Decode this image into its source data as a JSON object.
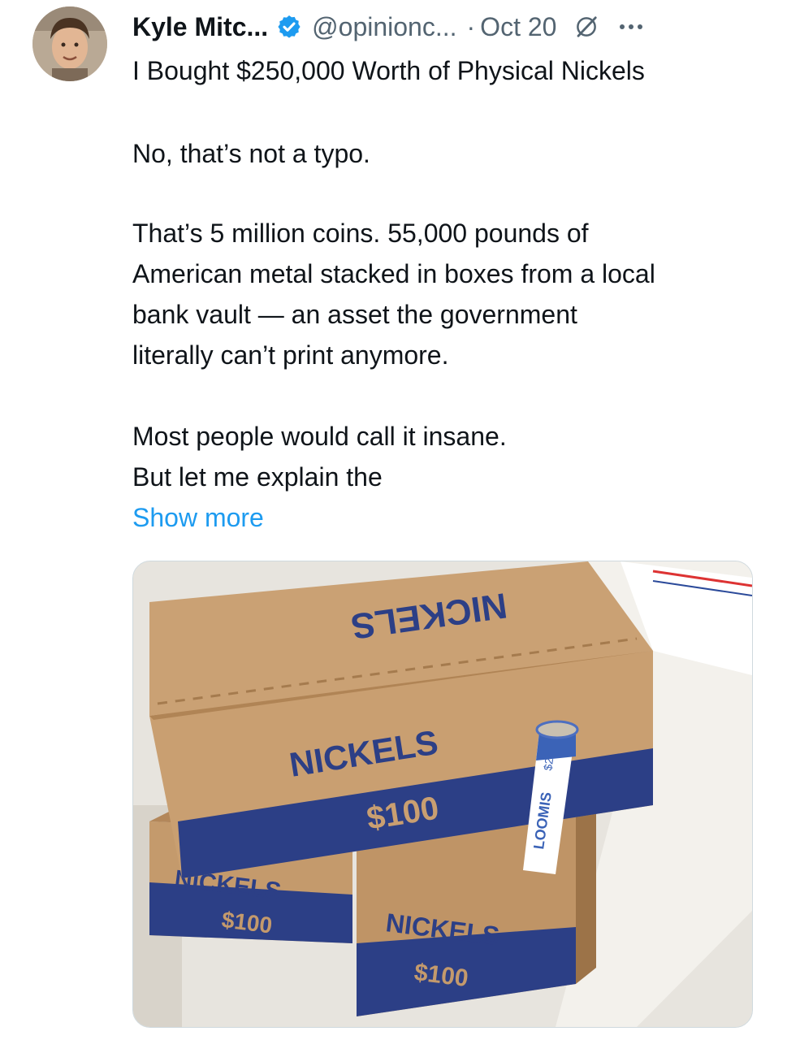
{
  "tweet": {
    "author_name": "Kyle Mitc...",
    "handle": "@opinionc...",
    "separator": "·",
    "date": "Oct 20",
    "title_line": "I Bought $250,000 Worth of Physical Nickels",
    "paragraphs": [
      "No, that’s not a typo.",
      "That’s 5 million coins. 55,000 pounds of",
      "American metal stacked in boxes from a local",
      "bank vault — an asset the government",
      "literally can’t print anymore.",
      "Most people would call it insane.",
      "But let me explain the"
    ],
    "show_more": "Show more"
  },
  "media": {
    "box_label": "NICKELS",
    "box_value": "$100",
    "roll_brand": "LOOMIS",
    "roll_value": "$2"
  },
  "icons": {
    "verified": "verified-badge-icon",
    "grok": "grok-icon",
    "more": "more-options-icon"
  },
  "colors": {
    "text": "#0f1419",
    "secondary": "#536471",
    "link": "#1d9bf0",
    "verified": "#1d9bf0",
    "box_blue": "#2c3f86",
    "cardboard": "#c49a6c"
  }
}
